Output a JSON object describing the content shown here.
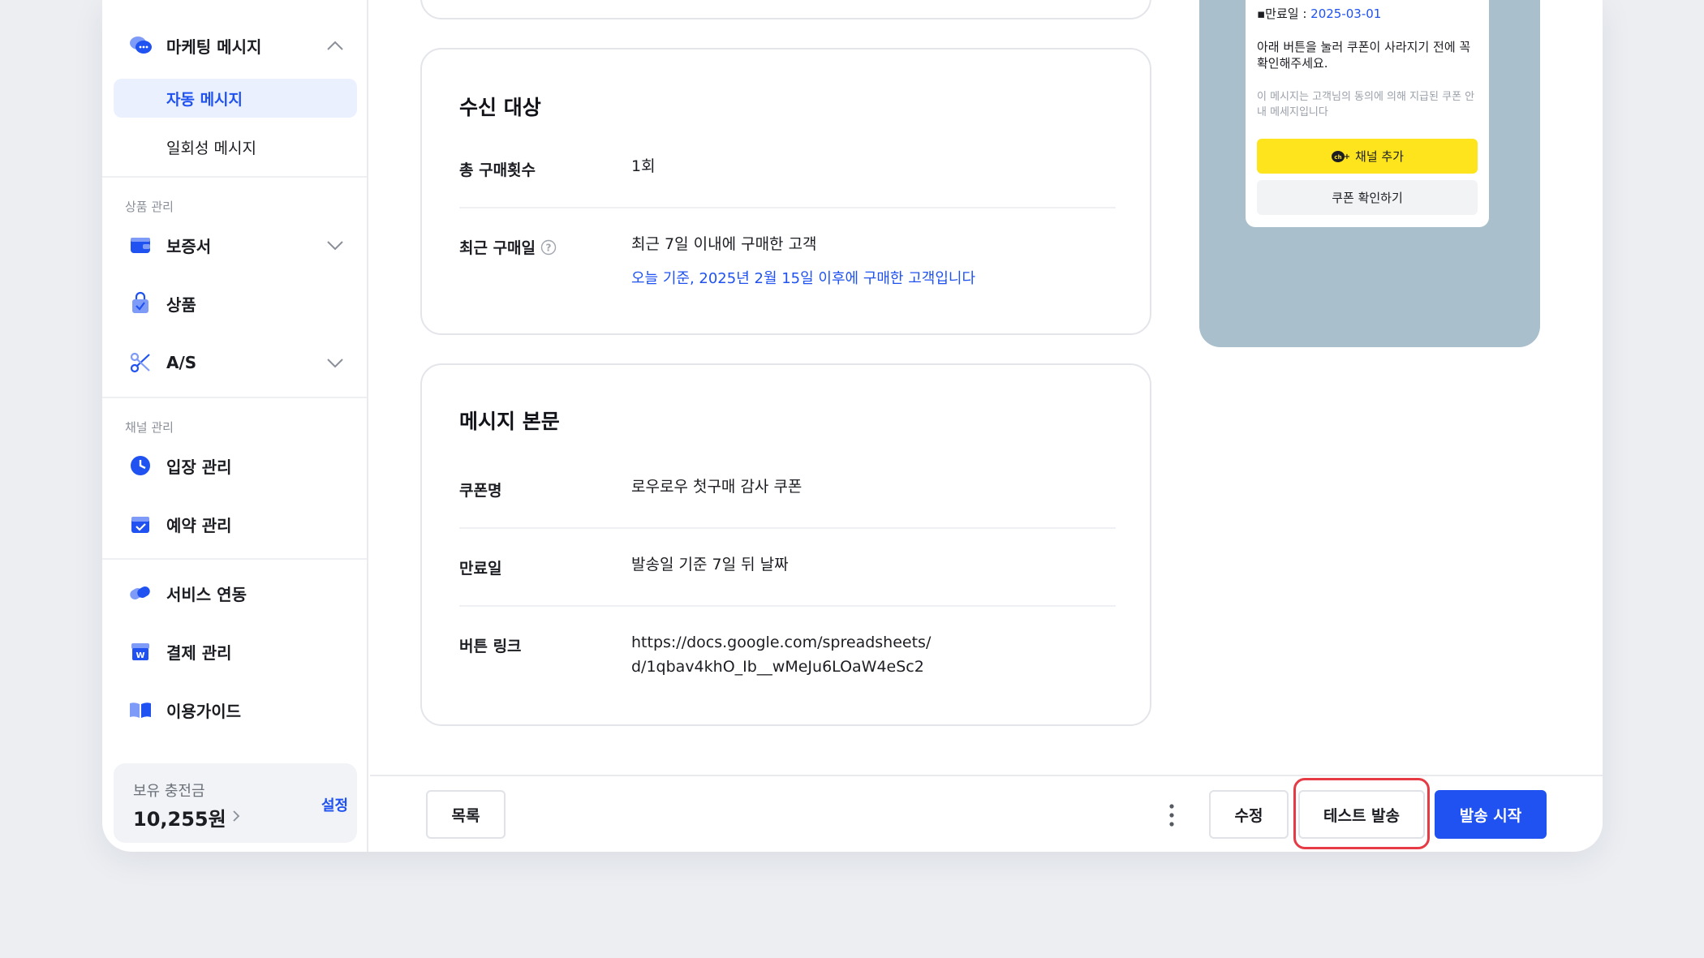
{
  "sidebar": {
    "marketing": {
      "label": "마케팅 메시지",
      "icon": "chat-bubbles-icon"
    },
    "sub_items": [
      {
        "label": "자동 메시지",
        "active": true
      },
      {
        "label": "일회성 메시지",
        "active": false
      }
    ],
    "product_section": "상품 관리",
    "product_items": [
      {
        "label": "보증서",
        "icon": "wallet-icon",
        "expandable": true
      },
      {
        "label": "상품",
        "icon": "shopping-bag-icon",
        "expandable": false
      },
      {
        "label": "A/S",
        "icon": "scissors-icon",
        "expandable": true
      }
    ],
    "channel_section": "채널 관리",
    "channel_items": [
      {
        "label": "입장 관리",
        "icon": "clock-icon"
      },
      {
        "label": "예약 관리",
        "icon": "calendar-icon"
      }
    ],
    "other_items": [
      {
        "label": "서비스 연동",
        "icon": "link-pill-icon"
      },
      {
        "label": "결제 관리",
        "icon": "won-store-icon"
      },
      {
        "label": "이용가이드",
        "icon": "book-icon"
      }
    ],
    "balance": {
      "label": "보유 충전금",
      "amount": "10,255원",
      "settings": "설정"
    }
  },
  "target_card": {
    "title": "수신 대상",
    "rows": [
      {
        "label": "총 구매횟수",
        "value": "1회"
      },
      {
        "label": "최근 구매일",
        "value": "최근 7일 이내에 구매한 고객",
        "sub": "오늘 기준, 2025년 2월 15일 이후에 구매한 고객입니다"
      }
    ]
  },
  "message_card": {
    "title": "메시지 본문",
    "rows": [
      {
        "label": "쿠폰명",
        "value": "로우로우 첫구매 감사 쿠폰"
      },
      {
        "label": "만료일",
        "value": "발송일 기준 7일 뒤 날짜"
      },
      {
        "label": "버튼 링크",
        "value_line1": "https://docs.google.com/spreadsheets/",
        "value_line2": "d/1qbav4khO_Ib__wMeJu6LOaW4eSc2"
      }
    ]
  },
  "preview": {
    "expire_prefix": "▪만료일 : ",
    "expire_date": "2025-03-01",
    "message": "아래 버튼을 눌러 쿠폰이 사라지기 전에 꼭 확인해주세요.",
    "notice": "이 메시지는 고객님의 동의에 의해 지급된 쿠폰 안내 메세지입니다",
    "channel_button": "채널 추가",
    "coupon_button": "쿠폰 확인하기"
  },
  "footer": {
    "list": "목록",
    "edit": "수정",
    "test_send": "테스트 발송",
    "start_send": "발송 시작"
  },
  "colors": {
    "accent": "#1f52f0",
    "highlight": "#e63b45",
    "kakao_yellow": "#fde41c",
    "preview_bg": "#a9bfcc"
  }
}
